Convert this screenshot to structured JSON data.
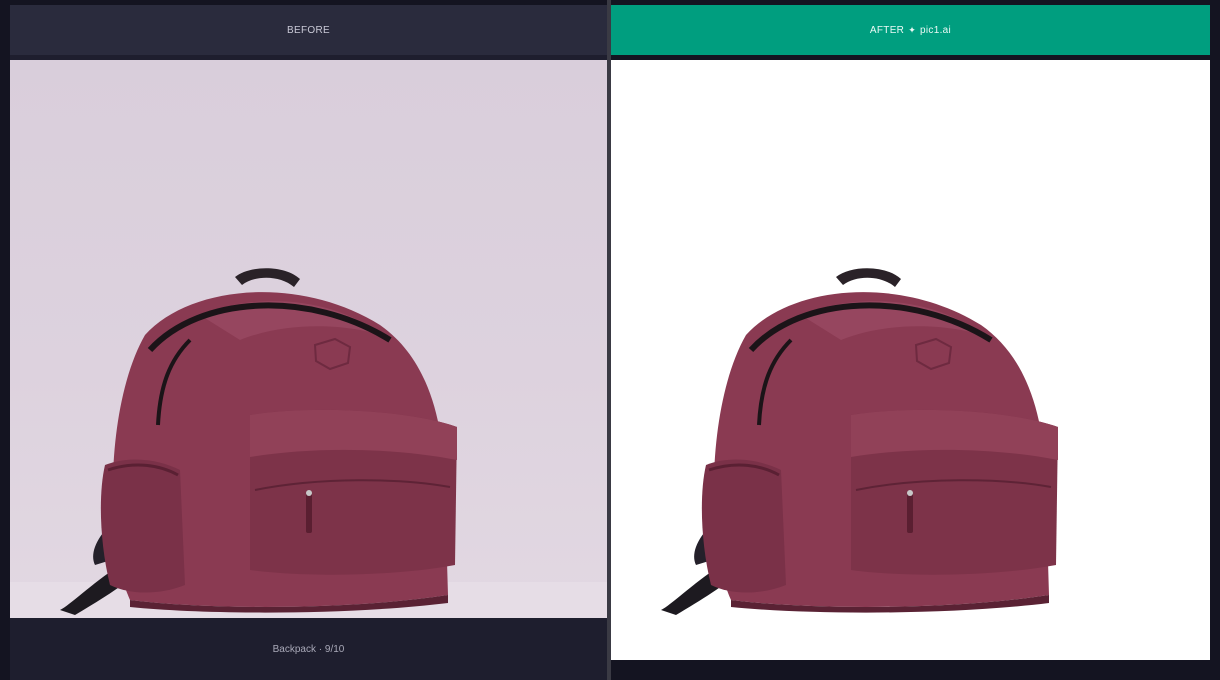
{
  "before": {
    "header_label": "BEFORE",
    "caption": "Backpack · 9/10"
  },
  "after": {
    "header_label": "AFTER",
    "brand": "pic1.ai",
    "header_icon": "sparkle-icon"
  },
  "colors": {
    "accent": "#009e7f",
    "bag": "#8a3a52",
    "before_bg": "#dcd1dd",
    "after_bg": "#ffffff"
  }
}
